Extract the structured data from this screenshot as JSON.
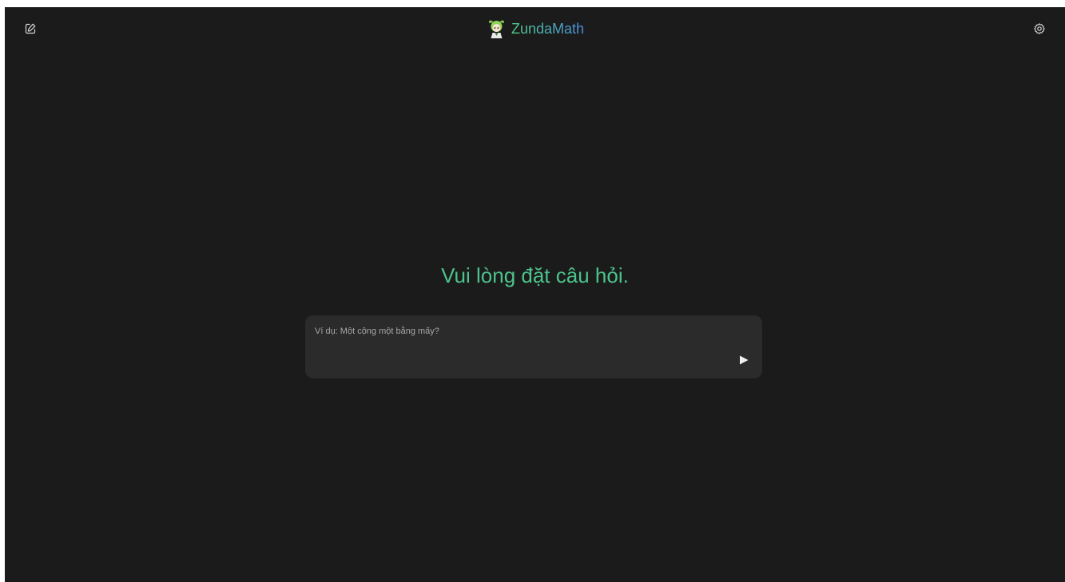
{
  "header": {
    "title": "ZundaMath",
    "logo_icon": "zundamon-avatar-icon",
    "new_chat_icon": "new-chat-icon",
    "settings_icon": "gear-icon"
  },
  "main": {
    "prompt_heading": "Vui lòng đặt câu hỏi."
  },
  "composer": {
    "placeholder": "Ví dụ: Một cộng một bằng mấy?",
    "value": "",
    "send_icon": "send-arrow-icon"
  },
  "colors": {
    "background": "#1b1b1b",
    "accent_green": "#4cc38a",
    "accent_blue": "#4a8fe0",
    "composer_bg": "#2b2b2b"
  }
}
